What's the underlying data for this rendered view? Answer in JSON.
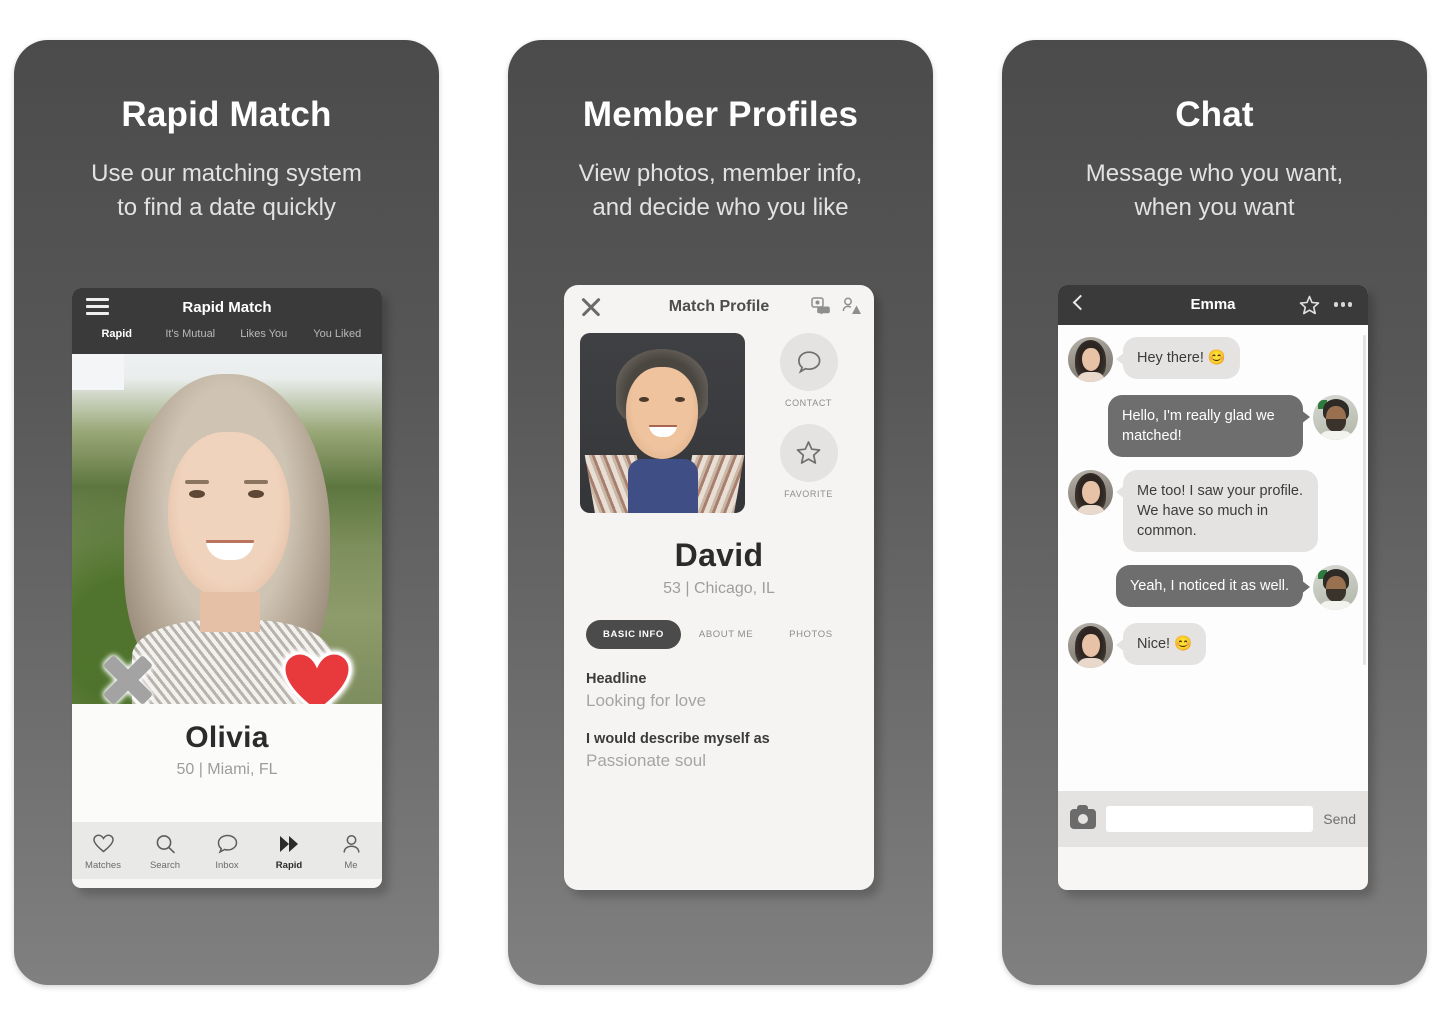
{
  "cards": [
    {
      "title": "Rapid Match",
      "subtitle": "Use our matching system\nto find a date quickly",
      "app": {
        "menu_icon": "hamburger-icon",
        "app_title": "Rapid Match",
        "tabs": [
          "Rapid",
          "It's Mutual",
          "Likes You",
          "You Liked"
        ],
        "active_tab": "Rapid",
        "reject_icon": "x-icon",
        "like_icon": "heart-icon",
        "profile_name": "Olivia",
        "profile_meta": "50 | Miami, FL",
        "nav": [
          {
            "label": "Matches",
            "icon": "heart-icon"
          },
          {
            "label": "Search",
            "icon": "search-icon"
          },
          {
            "label": "Inbox",
            "icon": "chat-bubble-icon"
          },
          {
            "label": "Rapid",
            "icon": "double-chevron-icon"
          },
          {
            "label": "Me",
            "icon": "person-icon"
          }
        ],
        "active_nav": "Rapid"
      }
    },
    {
      "title": "Member Profiles",
      "subtitle": "View photos, member info,\nand decide who you like",
      "app": {
        "close_icon": "close-icon",
        "screen_title": "Match Profile",
        "header_actions": [
          "photo-chat-icon",
          "block-user-icon"
        ],
        "contact_label": "CONTACT",
        "favorite_label": "FAVORITE",
        "profile_name": "David",
        "profile_meta": "53 | Chicago, IL",
        "tabs": [
          "BASIC INFO",
          "ABOUT ME",
          "PHOTOS"
        ],
        "active_tab": "BASIC INFO",
        "fields": [
          {
            "label": "Headline",
            "value": "Looking for love"
          },
          {
            "label": "I would describe myself as",
            "value": "Passionate soul"
          }
        ]
      }
    },
    {
      "title": "Chat",
      "subtitle": "Message who you want,\nwhen you want",
      "app": {
        "back_icon": "back-chevron-icon",
        "contact_name": "Emma",
        "star_icon": "star-icon",
        "more_icon": "ellipsis-icon",
        "messages": [
          {
            "dir": "in",
            "text": "Hey there! 😊",
            "avatar": "female"
          },
          {
            "dir": "out",
            "text": "Hello, I'm really glad we matched!",
            "avatar": "male"
          },
          {
            "dir": "in",
            "text": "Me too! I saw your profile. We have so much in common.",
            "avatar": "female"
          },
          {
            "dir": "out",
            "text": "Yeah, I noticed it as well.",
            "avatar": "male"
          },
          {
            "dir": "in",
            "text": "Nice! 😊",
            "avatar": "female"
          }
        ],
        "camera_icon": "camera-icon",
        "input_value": "",
        "input_placeholder": "",
        "send_label": "Send"
      }
    }
  ],
  "colors": {
    "card_bg_top": "#4b4b4b",
    "card_bg_bottom": "#808080",
    "accent_heart": "#e8393c",
    "bubble_in": "#e4e3e2",
    "bubble_out": "#6e6e6e",
    "topbar": "#3a3a3a"
  }
}
